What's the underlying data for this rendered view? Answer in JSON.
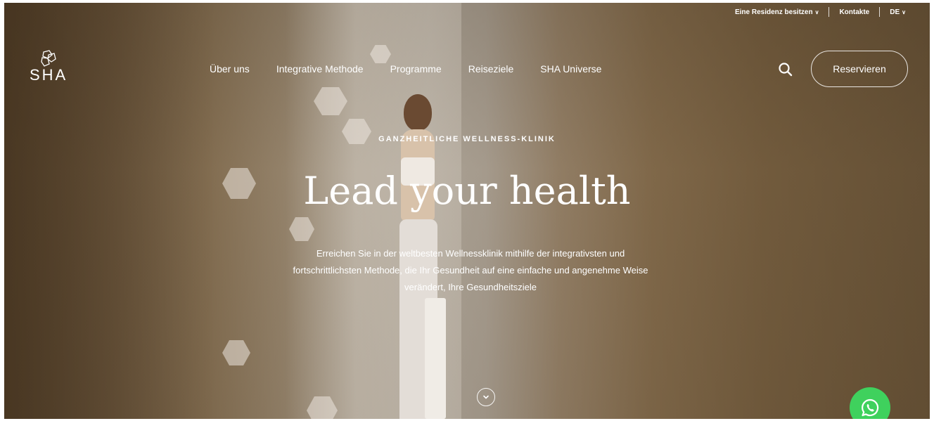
{
  "utility_nav": {
    "residence": "Eine Residenz besitzen",
    "contacts": "Kontakte",
    "language": "DE"
  },
  "brand": {
    "name": "SHA"
  },
  "nav": {
    "items": [
      "Über uns",
      "Integrative Methode",
      "Programme",
      "Reiseziele",
      "SHA Universe"
    ]
  },
  "actions": {
    "reserve": "Reservieren"
  },
  "hero": {
    "eyebrow": "GANZHEITLICHE WELLNESS-KLINIK",
    "title": "Lead your health",
    "lines": [
      "Erreichen Sie in der weltbesten Wellnessklinik mithilfe der integrativsten und",
      "fortschrittlichsten Methode, die Ihr Gesundheit auf eine einfache und angenehme Weise",
      "verändert, Ihre Gesundheitsziele"
    ]
  },
  "icons": {
    "search": "search-icon",
    "scroll": "chevron-down-icon",
    "chat": "whatsapp-icon"
  },
  "colors": {
    "whatsapp": "#3fd15d",
    "text": "#ffffff"
  }
}
